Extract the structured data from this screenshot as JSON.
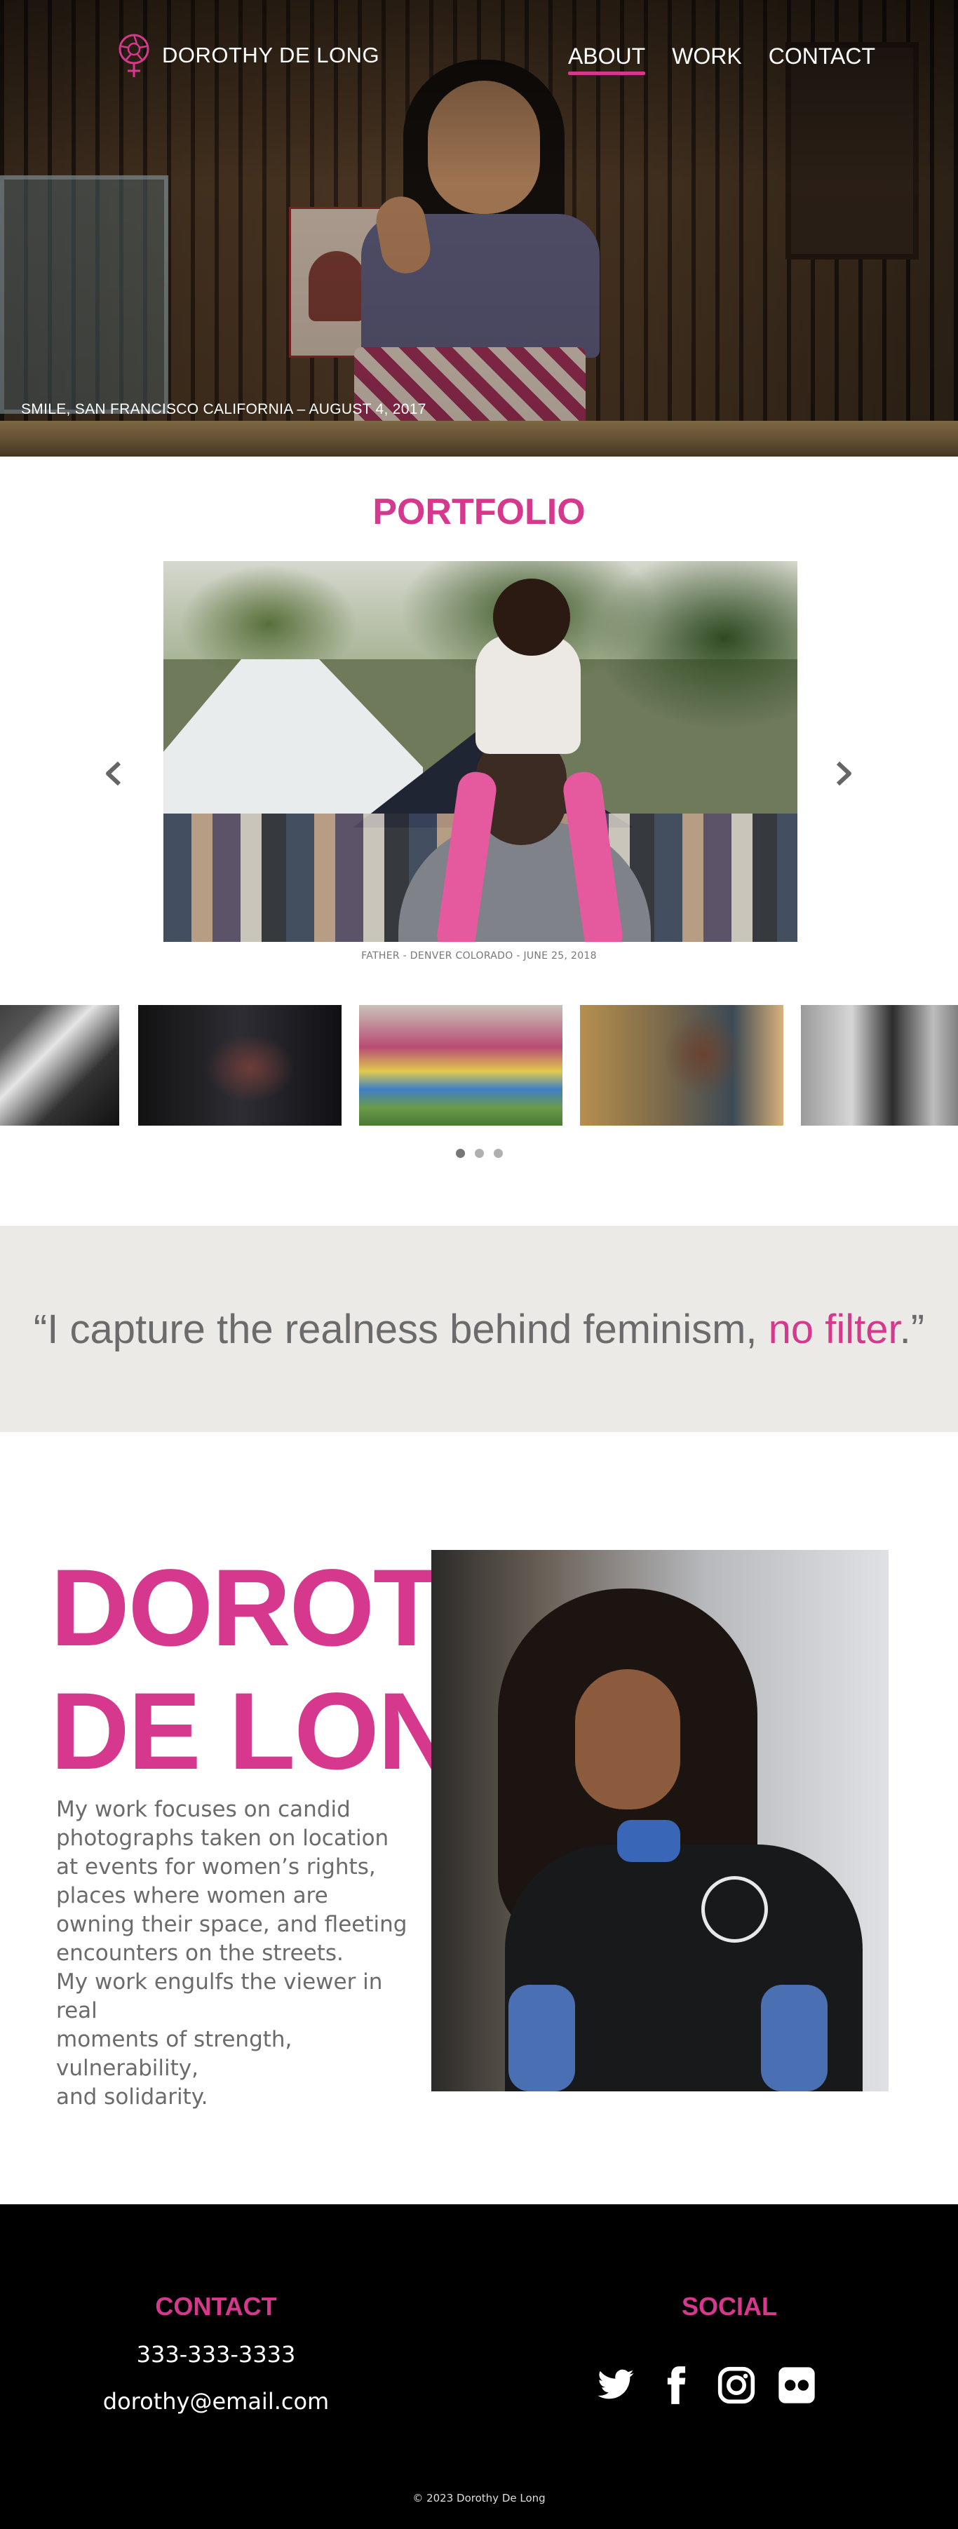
{
  "brand": {
    "name": "DOROTHY DE LONG",
    "accent_color": "#d6388d"
  },
  "nav": [
    {
      "label": "ABOUT",
      "active": true
    },
    {
      "label": "WORK",
      "active": false
    },
    {
      "label": "CONTACT",
      "active": false
    }
  ],
  "hero": {
    "caption": "SMILE, SAN FRANCISCO CALIFORNIA – AUGUST 4, 2017"
  },
  "portfolio": {
    "title": "PORTFOLIO",
    "main_caption": "FATHER - DENVER COLORADO - JUNE 25, 2018",
    "prev_icon": "chevron-left-icon",
    "next_icon": "chevron-right-icon",
    "dots": {
      "count": 3,
      "active_index": 0
    }
  },
  "quote": {
    "open": "“",
    "text": "I capture the realness behind feminism, ",
    "accent": "no filter",
    "close": ".”"
  },
  "about": {
    "name_line1": "DOROTHY",
    "name_line2": "DE LONG",
    "bio_line1": "My work focuses on candid",
    "bio_line2": "photographs taken on location",
    "bio_line3": "at events for women’s rights,",
    "bio_line4": "places where women are",
    "bio_line5": "owning their space, and fleeting",
    "bio_line6": "encounters on the streets.",
    "bio_line7": "My work engulfs the viewer in real",
    "bio_line8": "moments of strength, vulnerability,",
    "bio_line9": "and solidarity."
  },
  "footer": {
    "contact_heading": "CONTACT",
    "phone": "333-333-3333",
    "email": "dorothy@email.com",
    "social_heading": "SOCIAL",
    "social_icons": [
      "twitter-icon",
      "facebook-icon",
      "instagram-icon",
      "flickr-icon"
    ],
    "copyright": "© 2023 Dorothy De Long"
  }
}
